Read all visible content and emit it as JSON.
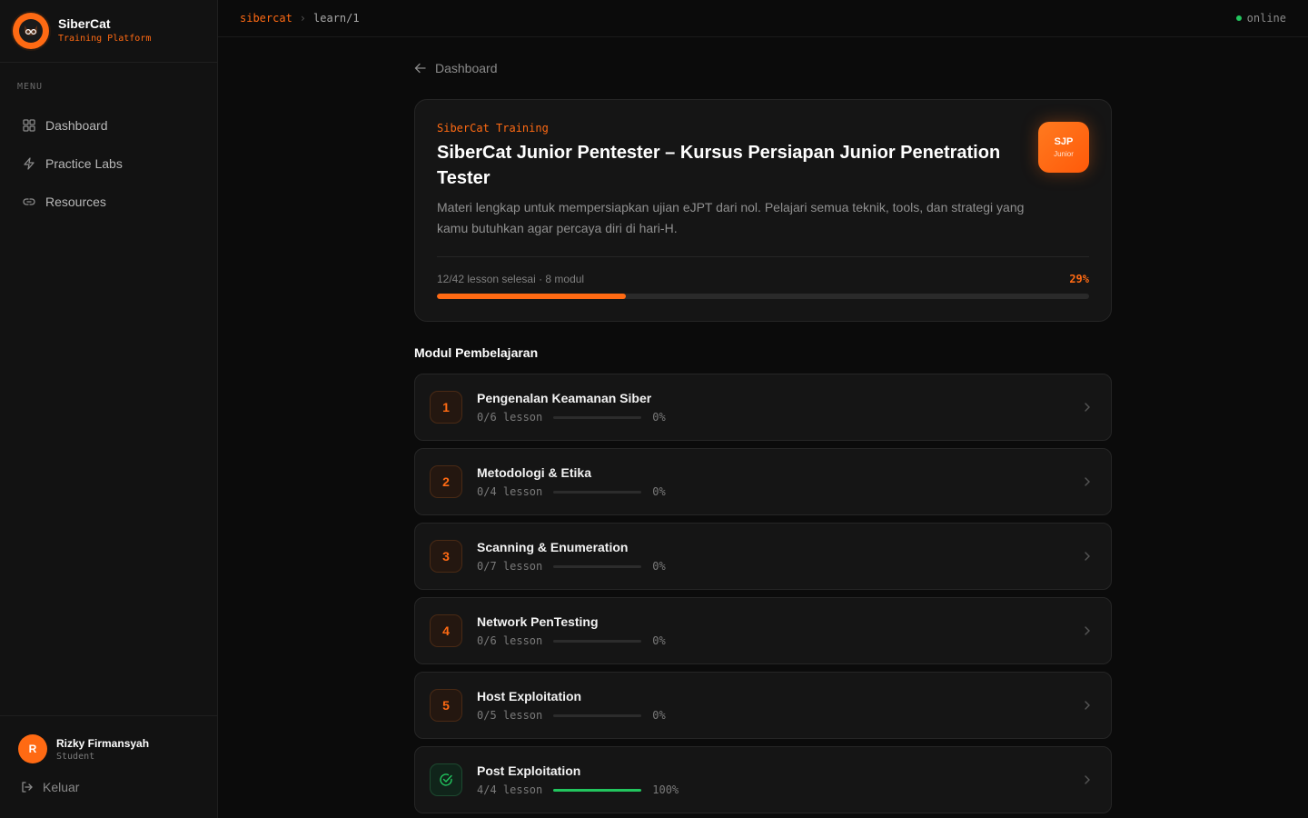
{
  "brand": {
    "name": "SiberCat",
    "subtitle": "Training Platform"
  },
  "sidebar": {
    "menu_label": "MENU",
    "items": [
      {
        "label": "Dashboard",
        "icon": "grid-icon"
      },
      {
        "label": "Practice Labs",
        "icon": "bolt-icon"
      },
      {
        "label": "Resources",
        "icon": "link-icon"
      }
    ],
    "user": {
      "initial": "R",
      "name": "Rizky Firmansyah",
      "role": "Student"
    },
    "logout_label": "Keluar"
  },
  "topbar": {
    "root": "sibercat",
    "separator": "›",
    "page": "learn/1",
    "status": "online"
  },
  "back": {
    "label": "Dashboard"
  },
  "course": {
    "kicker": "SiberCat Training",
    "title": "SiberCat Junior Pentester – Kursus Persiapan Junior Penetration Tester",
    "description": "Materi lengkap untuk mempersiapkan ujian eJPT dari nol. Pelajari semua teknik, tools, dan strategi yang kamu butuhkan agar percaya diri di hari-H.",
    "badge_code": "SJP",
    "badge_level": "Junior",
    "progress_text": "12/42 lesson selesai · 8 modul",
    "progress_pct": "29%",
    "progress_value": 29,
    "accent_color": "#ff6a13"
  },
  "modules_title": "Modul Pembelajaran",
  "modules": [
    {
      "num": "1",
      "title": "Pengenalan Keamanan Siber",
      "lessons": "0/6 lesson",
      "pct": "0%",
      "progress": 0,
      "done": false
    },
    {
      "num": "2",
      "title": "Metodologi & Etika",
      "lessons": "0/4 lesson",
      "pct": "0%",
      "progress": 0,
      "done": false
    },
    {
      "num": "3",
      "title": "Scanning & Enumeration",
      "lessons": "0/7 lesson",
      "pct": "0%",
      "progress": 0,
      "done": false
    },
    {
      "num": "4",
      "title": "Network PenTesting",
      "lessons": "0/6 lesson",
      "pct": "0%",
      "progress": 0,
      "done": false
    },
    {
      "num": "5",
      "title": "Host Exploitation",
      "lessons": "0/5 lesson",
      "pct": "0%",
      "progress": 0,
      "done": false
    },
    {
      "num": "",
      "title": "Post Exploitation",
      "lessons": "4/4 lesson",
      "pct": "100%",
      "progress": 100,
      "done": true
    }
  ]
}
